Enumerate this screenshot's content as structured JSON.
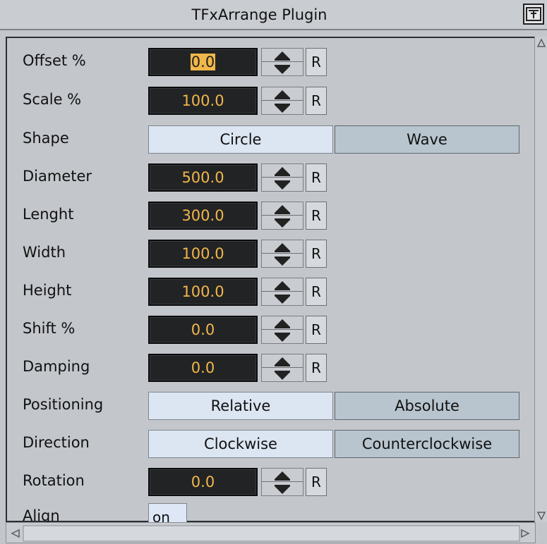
{
  "window": {
    "title": "TFxArrange Plugin"
  },
  "fields": [
    {
      "label": "Offset %",
      "value": "0.0"
    },
    {
      "label": "Scale %",
      "value": "100.0"
    },
    {
      "label": "Diameter",
      "value": "500.0"
    },
    {
      "label": "Lenght",
      "value": "300.0"
    },
    {
      "label": "Width",
      "value": "100.0"
    },
    {
      "label": "Height",
      "value": "100.0"
    },
    {
      "label": "Shift %",
      "value": "0.0"
    },
    {
      "label": "Damping",
      "value": "0.0"
    },
    {
      "label": "Rotation",
      "value": "0.0"
    }
  ],
  "shape": {
    "label": "Shape",
    "options": [
      "Circle",
      "Wave"
    ],
    "selected": "Circle"
  },
  "positioning": {
    "label": "Positioning",
    "options": [
      "Relative",
      "Absolute"
    ],
    "selected": "Relative"
  },
  "direction": {
    "label": "Direction",
    "options": [
      "Clockwise",
      "Counterclockwise"
    ],
    "selected": "Clockwise"
  },
  "align": {
    "label": "Align",
    "value": "on"
  },
  "reset_label": "R",
  "colors": {
    "field_bg": "#222325",
    "field_text": "#f1b74a",
    "toggle_selected": "#dce5f2",
    "toggle_unselected": "#b8c5ce",
    "panel_bg": "#c3c6cb"
  }
}
